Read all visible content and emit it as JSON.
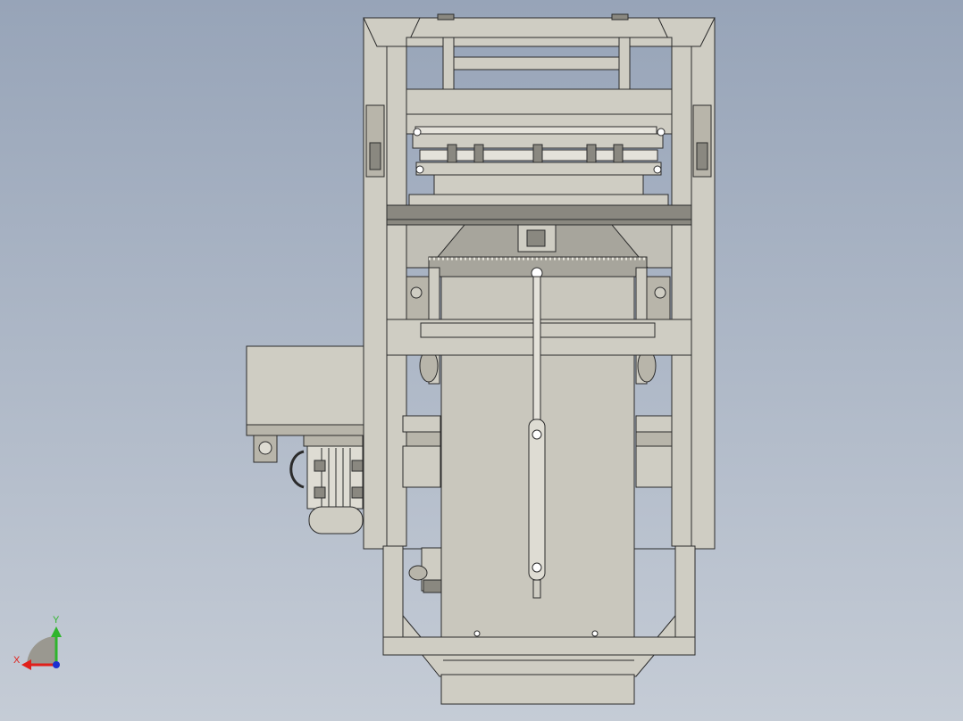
{
  "viewport": {
    "background_top": "#97a4b8",
    "background_bottom": "#c5ccd6"
  },
  "model": {
    "fill_color": "#cfcdc3",
    "shade_color": "#b8b5aa",
    "edge_color": "#2b2b2b",
    "dark_band_color": "#8a8880"
  },
  "triad": {
    "x_label": "X",
    "y_label": "Y",
    "x_color": "#e0201a",
    "y_color": "#2fb52c",
    "z_color": "#1a2fd0"
  }
}
